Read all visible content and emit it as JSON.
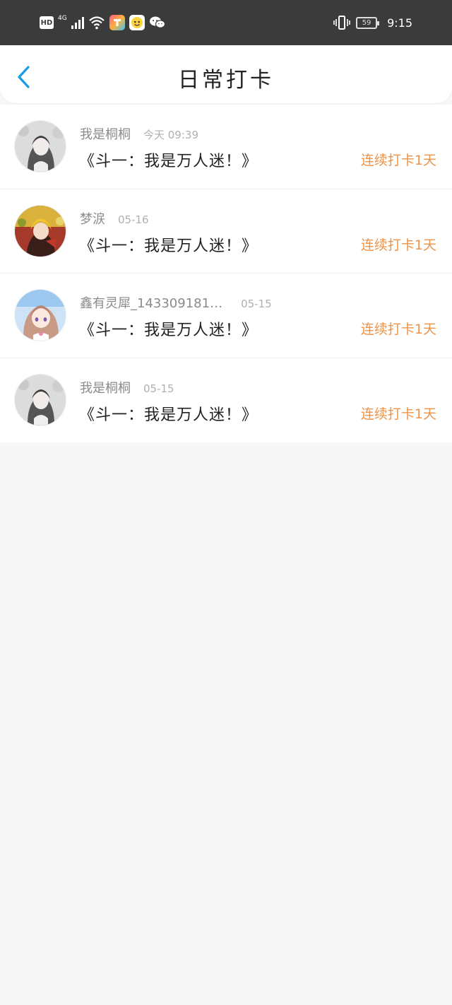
{
  "status_bar": {
    "hd": "HD",
    "network": "4G",
    "time": "9:15",
    "battery": "59"
  },
  "header": {
    "title": "日常打卡",
    "accent": "#1a9be8"
  },
  "checkins": [
    {
      "name": "我是桐桐",
      "date": "今天 09:39",
      "book": "《斗一：我是万人迷！》",
      "streak": "连续打卡1天",
      "avatar_theme": "gray-girl"
    },
    {
      "name": "梦涙",
      "date": "05-16",
      "book": "《斗一：我是万人迷！》",
      "streak": "连续打卡1天",
      "avatar_theme": "blonde-boy"
    },
    {
      "name": "鑫有灵犀_143309181…",
      "date": "05-15",
      "book": "《斗一：我是万人迷！》",
      "streak": "连续打卡1天",
      "avatar_theme": "pink-girl"
    },
    {
      "name": "我是桐桐",
      "date": "05-15",
      "book": "《斗一：我是万人迷！》",
      "streak": "连续打卡1天",
      "avatar_theme": "gray-girl"
    }
  ],
  "colors": {
    "streak": "#f09346",
    "name": "#8b8b8b",
    "background": "#f8f7f7"
  }
}
